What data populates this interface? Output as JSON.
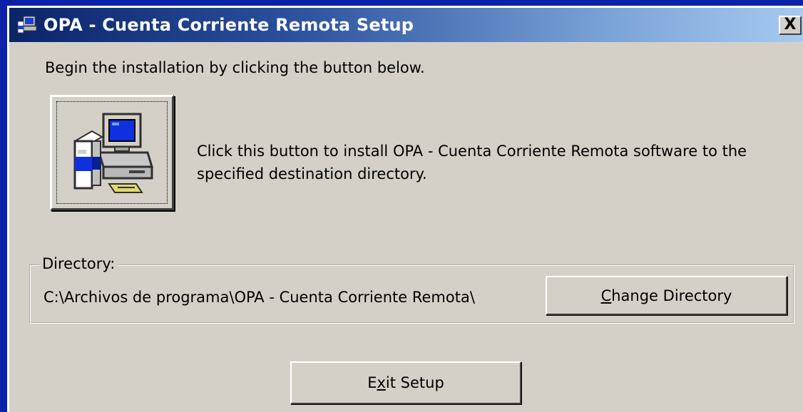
{
  "window": {
    "title": "OPA - Cuenta Corriente Remota Setup",
    "close_label": "X"
  },
  "main": {
    "intro_text": "Begin the installation by clicking the button below.",
    "install_description": "Click this button to install OPA - Cuenta Corriente Remota software to the specified destination directory."
  },
  "directory": {
    "label": "Directory:",
    "path": "C:\\Archivos de programa\\OPA - Cuenta Corriente Remota\\",
    "change_button": {
      "accel": "C",
      "rest": "hange Directory"
    }
  },
  "footer": {
    "exit_button": {
      "before": "E",
      "accel": "x",
      "after": "it Setup"
    }
  },
  "colors": {
    "desktop": "#0b22a8",
    "dialog_face": "#d4d0c8",
    "title_gradient_start": "#0a246a",
    "title_gradient_end": "#a6caf0"
  }
}
